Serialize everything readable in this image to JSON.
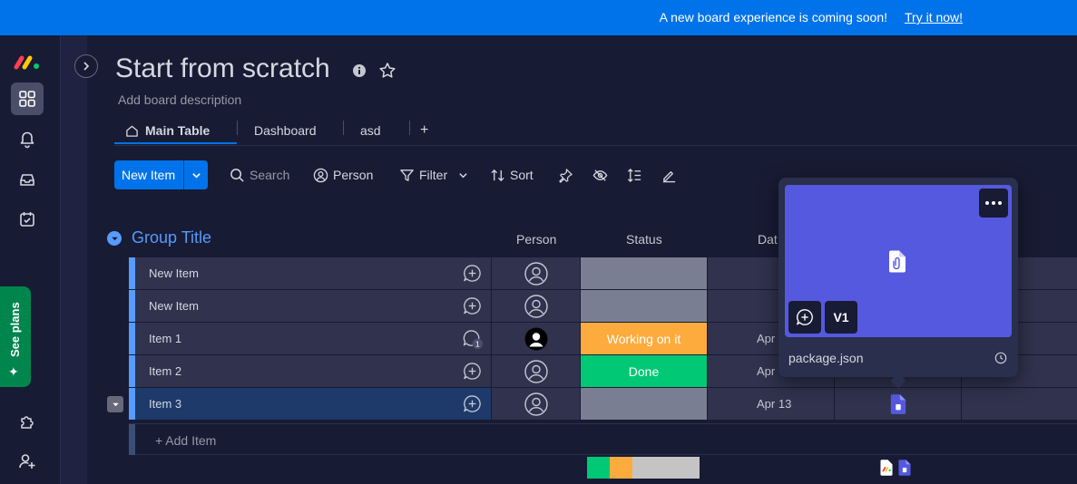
{
  "banner": {
    "message": "A new board experience is coming soon!",
    "cta": "Try it now!"
  },
  "rail": {
    "icons": [
      "monday-logo-icon",
      "workspace-grid-icon",
      "bell-icon",
      "inbox-icon",
      "my-work-icon",
      "puzzle-icon",
      "invite-user-icon"
    ],
    "see_plans": "See plans"
  },
  "board": {
    "title": "Start from scratch",
    "description": "Add board description"
  },
  "tabs": [
    {
      "label": "Main Table",
      "active": true
    },
    {
      "label": "Dashboard"
    },
    {
      "label": "asd"
    }
  ],
  "tab_add": "+",
  "toolbar": {
    "new_item": "New Item",
    "search": "Search",
    "person": "Person",
    "filter": "Filter",
    "sort": "Sort"
  },
  "group": {
    "title": "Group Title",
    "color": "#579bfc"
  },
  "columns": {
    "person": "Person",
    "status": "Status",
    "date": "Dat"
  },
  "rows": [
    {
      "name": "New Item",
      "status": "",
      "date": ""
    },
    {
      "name": "New Item",
      "status": "",
      "date": ""
    },
    {
      "name": "Item 1",
      "updates": "1",
      "status": "Working on it",
      "status_color": "#fdab3d",
      "date": "Apr"
    },
    {
      "name": "Item 2",
      "status": "Done",
      "status_color": "#00c875",
      "date": "Apr"
    },
    {
      "name": "Item 3",
      "status": "",
      "date": "Apr 13"
    }
  ],
  "add_item": "+ Add Item",
  "status_colors": {
    "done": "#00c875",
    "working": "#fdab3d",
    "empty": "#797e93"
  },
  "file_popup": {
    "version": "V1",
    "filename": "package.json"
  }
}
